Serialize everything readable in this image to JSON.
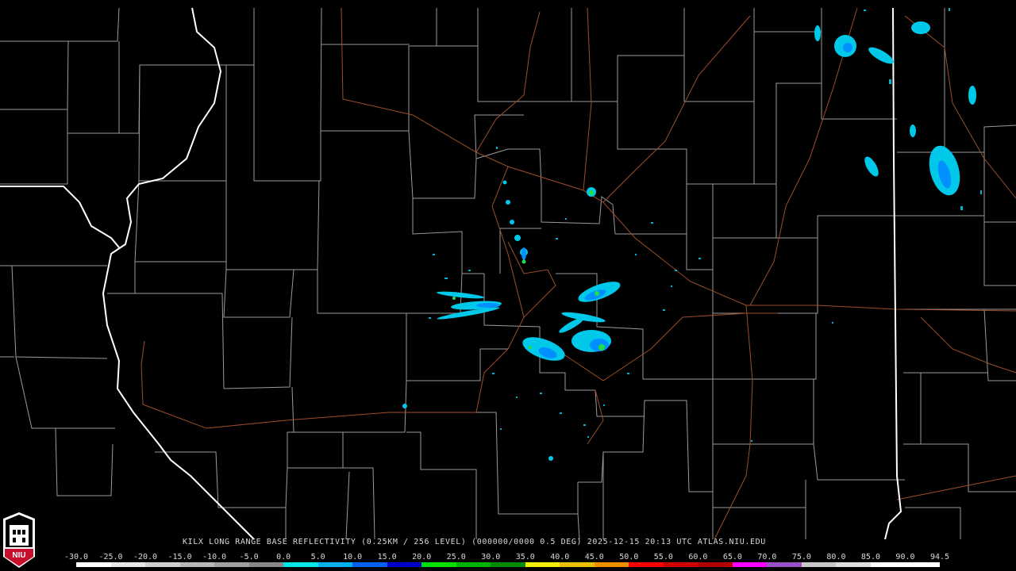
{
  "radar": {
    "caption_parts": [
      "KILX LONG RANGE BASE REFLECTIVITY (0.25KM / 256 LEVEL) (000000/0000 0.5 DEG)",
      "2025-12-15 20:13 UTC",
      "ATLAS.NIU.EDU"
    ],
    "logo_text": "NIU"
  },
  "colorbar": {
    "ticks": [
      "-30.0",
      "-25.0",
      "-20.0",
      "-15.0",
      "-10.0",
      "-5.0",
      "0.0",
      "5.0",
      "10.0",
      "15.0",
      "20.0",
      "25.0",
      "30.0",
      "35.0",
      "40.0",
      "45.0",
      "50.0",
      "55.0",
      "60.0",
      "65.0",
      "70.0",
      "75.0",
      "80.0",
      "85.0",
      "90.0",
      "94.5"
    ],
    "colors": [
      "#ffffff",
      "#e8e8e8",
      "#d0d0d0",
      "#b8b8b8",
      "#a0a0a0",
      "#888888",
      "#00e8e8",
      "#00b0f0",
      "#0060f0",
      "#0000c8",
      "#00e000",
      "#00b400",
      "#008a00",
      "#f0f000",
      "#e8c000",
      "#f09000",
      "#ff0000",
      "#d00000",
      "#b00000",
      "#ff00ff",
      "#9a50c8",
      "#c8c8c8",
      "#e0e0e0",
      "#ffffff",
      "#ffffff"
    ]
  },
  "colors": {
    "state_border": "#ffffff",
    "county_border": "#a8a8a8",
    "highway": "#a05030",
    "echo_light": "#00ccee",
    "echo_mid": "#0099ff",
    "echo_strong": "#22dd44"
  }
}
